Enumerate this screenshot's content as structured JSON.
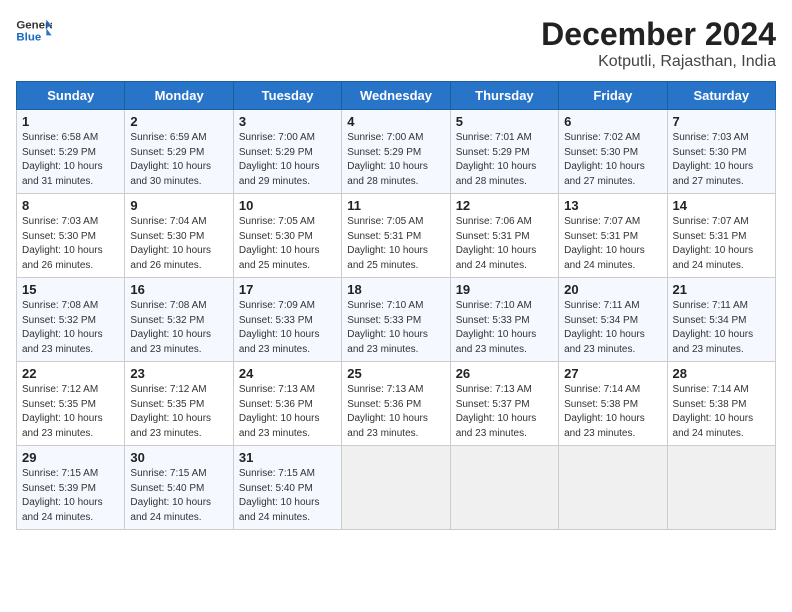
{
  "header": {
    "logo_line1": "General",
    "logo_line2": "Blue",
    "title": "December 2024",
    "subtitle": "Kotputli, Rajasthan, India"
  },
  "calendar": {
    "weekdays": [
      "Sunday",
      "Monday",
      "Tuesday",
      "Wednesday",
      "Thursday",
      "Friday",
      "Saturday"
    ],
    "rows": [
      [
        {
          "day": "1",
          "sunrise": "6:58 AM",
          "sunset": "5:29 PM",
          "daylight": "10 hours and 31 minutes."
        },
        {
          "day": "2",
          "sunrise": "6:59 AM",
          "sunset": "5:29 PM",
          "daylight": "10 hours and 30 minutes."
        },
        {
          "day": "3",
          "sunrise": "7:00 AM",
          "sunset": "5:29 PM",
          "daylight": "10 hours and 29 minutes."
        },
        {
          "day": "4",
          "sunrise": "7:00 AM",
          "sunset": "5:29 PM",
          "daylight": "10 hours and 28 minutes."
        },
        {
          "day": "5",
          "sunrise": "7:01 AM",
          "sunset": "5:29 PM",
          "daylight": "10 hours and 28 minutes."
        },
        {
          "day": "6",
          "sunrise": "7:02 AM",
          "sunset": "5:30 PM",
          "daylight": "10 hours and 27 minutes."
        },
        {
          "day": "7",
          "sunrise": "7:03 AM",
          "sunset": "5:30 PM",
          "daylight": "10 hours and 27 minutes."
        }
      ],
      [
        {
          "day": "8",
          "sunrise": "7:03 AM",
          "sunset": "5:30 PM",
          "daylight": "10 hours and 26 minutes."
        },
        {
          "day": "9",
          "sunrise": "7:04 AM",
          "sunset": "5:30 PM",
          "daylight": "10 hours and 26 minutes."
        },
        {
          "day": "10",
          "sunrise": "7:05 AM",
          "sunset": "5:30 PM",
          "daylight": "10 hours and 25 minutes."
        },
        {
          "day": "11",
          "sunrise": "7:05 AM",
          "sunset": "5:31 PM",
          "daylight": "10 hours and 25 minutes."
        },
        {
          "day": "12",
          "sunrise": "7:06 AM",
          "sunset": "5:31 PM",
          "daylight": "10 hours and 24 minutes."
        },
        {
          "day": "13",
          "sunrise": "7:07 AM",
          "sunset": "5:31 PM",
          "daylight": "10 hours and 24 minutes."
        },
        {
          "day": "14",
          "sunrise": "7:07 AM",
          "sunset": "5:31 PM",
          "daylight": "10 hours and 24 minutes."
        }
      ],
      [
        {
          "day": "15",
          "sunrise": "7:08 AM",
          "sunset": "5:32 PM",
          "daylight": "10 hours and 23 minutes."
        },
        {
          "day": "16",
          "sunrise": "7:08 AM",
          "sunset": "5:32 PM",
          "daylight": "10 hours and 23 minutes."
        },
        {
          "day": "17",
          "sunrise": "7:09 AM",
          "sunset": "5:33 PM",
          "daylight": "10 hours and 23 minutes."
        },
        {
          "day": "18",
          "sunrise": "7:10 AM",
          "sunset": "5:33 PM",
          "daylight": "10 hours and 23 minutes."
        },
        {
          "day": "19",
          "sunrise": "7:10 AM",
          "sunset": "5:33 PM",
          "daylight": "10 hours and 23 minutes."
        },
        {
          "day": "20",
          "sunrise": "7:11 AM",
          "sunset": "5:34 PM",
          "daylight": "10 hours and 23 minutes."
        },
        {
          "day": "21",
          "sunrise": "7:11 AM",
          "sunset": "5:34 PM",
          "daylight": "10 hours and 23 minutes."
        }
      ],
      [
        {
          "day": "22",
          "sunrise": "7:12 AM",
          "sunset": "5:35 PM",
          "daylight": "10 hours and 23 minutes."
        },
        {
          "day": "23",
          "sunrise": "7:12 AM",
          "sunset": "5:35 PM",
          "daylight": "10 hours and 23 minutes."
        },
        {
          "day": "24",
          "sunrise": "7:13 AM",
          "sunset": "5:36 PM",
          "daylight": "10 hours and 23 minutes."
        },
        {
          "day": "25",
          "sunrise": "7:13 AM",
          "sunset": "5:36 PM",
          "daylight": "10 hours and 23 minutes."
        },
        {
          "day": "26",
          "sunrise": "7:13 AM",
          "sunset": "5:37 PM",
          "daylight": "10 hours and 23 minutes."
        },
        {
          "day": "27",
          "sunrise": "7:14 AM",
          "sunset": "5:38 PM",
          "daylight": "10 hours and 23 minutes."
        },
        {
          "day": "28",
          "sunrise": "7:14 AM",
          "sunset": "5:38 PM",
          "daylight": "10 hours and 24 minutes."
        }
      ],
      [
        {
          "day": "29",
          "sunrise": "7:15 AM",
          "sunset": "5:39 PM",
          "daylight": "10 hours and 24 minutes."
        },
        {
          "day": "30",
          "sunrise": "7:15 AM",
          "sunset": "5:40 PM",
          "daylight": "10 hours and 24 minutes."
        },
        {
          "day": "31",
          "sunrise": "7:15 AM",
          "sunset": "5:40 PM",
          "daylight": "10 hours and 24 minutes."
        },
        null,
        null,
        null,
        null
      ]
    ]
  }
}
